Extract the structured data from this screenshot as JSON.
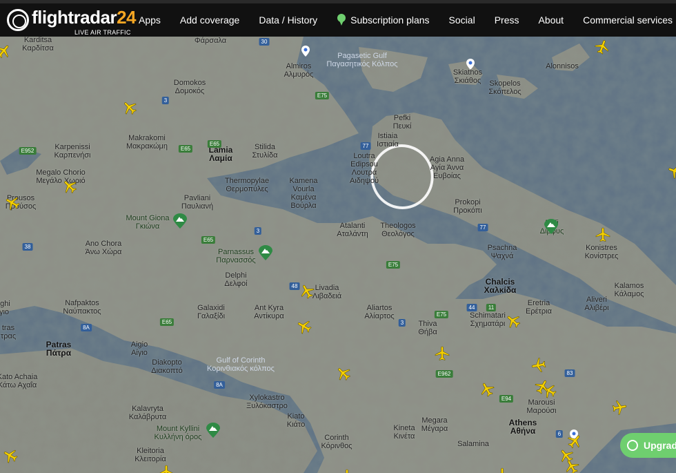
{
  "header": {
    "logo_text": "flightradar",
    "logo_num": "24",
    "logo_sub": "LIVE AIR TRAFFIC",
    "nav": [
      "Apps",
      "Add coverage",
      "Data / History",
      "Subscription plans",
      "Social",
      "Press",
      "About",
      "Commercial services"
    ]
  },
  "map": {
    "places": {
      "karditsa": "Karditsa\nΚαρδίτσα",
      "farsala": "Φάρσαλα",
      "almiros": "Almiros\nΑλμυρός",
      "pagasetic": "Pagasetic Gulf\nΠαγασητικός Κόλπος",
      "skiathos": "Skiathos\nΣκιάθος",
      "skopelos": "Skopelos\nΣκόπελος",
      "alonnisos": "Alonnisos",
      "domokos": "Domokos\nΔομοκός",
      "makrakomi": "Makrakomi\nΜακρακώμη",
      "karpenissi": "Karpenissi\nΚαρπενήσι",
      "lamia": "Lamia\nΛαμία",
      "stilida": "Stilida\nΣτυλίδα",
      "pefki": "Pefki\nΠευκί",
      "istiaia": "Istiaia\nΙστιαία",
      "loutra": "Loutra\nEdipsou\nΛουτρά\nΑιδηψού",
      "agia_anna": "Agia Anna\nΑγία Άννα\nΕυβοίας",
      "megalo": "Megalo Chorio\nΜεγάλο Χωριό",
      "thermopylae": "Thermopylae\nΘερμοπύλες",
      "kamena": "Kamena\nVourla\nΚαμένα\nΒούρλα",
      "prousos": "Prousos\nΠρούσος",
      "pavliani": "Pavliani\nΠαυλιανή",
      "prokopi": "Prokopi\nΠροκόπι",
      "dirfi": "Dirfi\nΔίρφυς",
      "mount_giona": "Mount Giona\nΓκιώνα",
      "atalanti": "Atalanti\nΑταλάντη",
      "theologos": "Theologos\nΘεολόγος",
      "ano_chora": "Ano Chora\nΆνω Χώρα",
      "psachna": "Psachna\nΨαχνά",
      "konistres": "Konistres\nΚονίστρες",
      "parnassus": "Parnassus\nΠαρνασσός",
      "delphi": "Delphi\nΔελφοί",
      "livadia": "Livadia\nΛιβαδειά",
      "chalcis": "Chalcis\nΧαλκίδα",
      "kalamos": "Kalamos\nΚάλαμος",
      "aliveri": "Aliveri\nΑλιβέρι",
      "nafpaktos": "Nafpaktos\nΝαύπακτος",
      "galaxidi": "Galaxidi\nΓαλαξίδι",
      "antikyra": "Ant Kyra\nΑντίκυρα",
      "aliartos": "Aliartos\nΑλίαρτος",
      "eretria": "Eretria\nΕρέτρια",
      "thiva": "Thiva\nΘήβα",
      "schimatari": "Schimatari\nΣχηματάρι",
      "patras": "Patras\nΠάτρα",
      "aigio": "Aigio\nΑίγιο",
      "diakopto": "Diakopto\nΔιακοπτό",
      "gulf_corinth": "Gulf of Corinth\nΚορινθιακός κόλπος",
      "kato_achaia": "Kato Achaia\nΚάτω Αχαΐα",
      "kalavryta": "Kalavryta\nΚαλάβρυτα",
      "xylokastro": "Xylokastro\nΞυλόκαστρο",
      "marousi": "Marousi\nΜαρούσι",
      "athens": "Athens\nΑθήνα",
      "mount_kyllini": "Mount Kyllini\nΚυλλήνη όρος",
      "kiato": "Kiato\nΚιάτο",
      "corinth": "Corinth\nΚόρινθος",
      "kineta": "Kineta\nΚινέτα",
      "megara": "Megara\nΜέγαρα",
      "salamina": "Salamina",
      "kleitoria": "Kleitoria\nΚλειτορία",
      "ighi": "Ighi\nγιο",
      "tras": "tras\nτρας"
    },
    "roads": [
      "30",
      "E75",
      "3",
      "E952",
      "E65",
      "77",
      "E65",
      "38",
      "3",
      "E65",
      "E75",
      "48",
      "77",
      "8A",
      "E65",
      "3",
      "E75",
      "44",
      "11",
      "8A",
      "E962",
      "83",
      "E94",
      "6"
    ]
  },
  "upgrade_label": "Upgrade",
  "colors": {
    "topbar": "#111111",
    "logo_accent": "#f5a623",
    "subscription": "#6fcf6f",
    "plane": "#f5d000",
    "sea": "#5f7285",
    "land": "#8a8a82"
  }
}
